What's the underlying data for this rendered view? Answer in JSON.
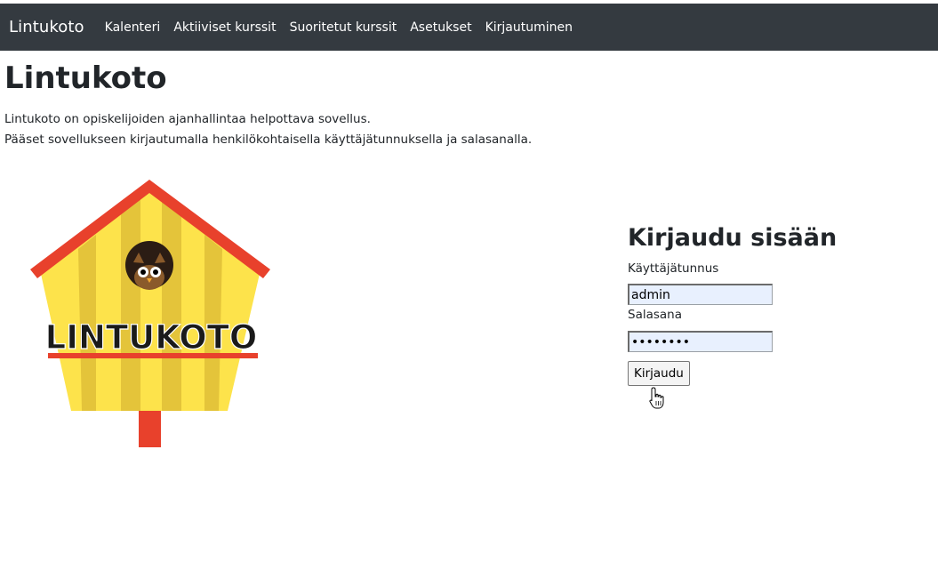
{
  "navbar": {
    "brand": "Lintukoto",
    "links": [
      "Kalenteri",
      "Aktiiviset kurssit",
      "Suoritetut kurssit",
      "Asetukset",
      "Kirjautuminen"
    ]
  },
  "page": {
    "title": "Lintukoto",
    "intro_lines": [
      "Lintukoto on opiskelijoiden ajanhallintaa helpottava sovellus.",
      "Pääset sovellukseen kirjautumalla henkilökohtaisella käyttäjätunnuksella ja salasanalla."
    ]
  },
  "logo": {
    "text": "LINTUKOTO",
    "icon": "birdhouse-owl-logo",
    "colors": {
      "roof": "#e8412c",
      "house": "#fde34b",
      "stripe": "#e4c43a",
      "post": "#e8412c",
      "text": "#1a1a1a"
    }
  },
  "login": {
    "heading": "Kirjaudu sisään",
    "username_label": "Käyttäjätunnus",
    "username_value": "admin",
    "password_label": "Salasana",
    "password_value": "••••••••",
    "submit_label": "Kirjaudu"
  },
  "colors": {
    "navbar_bg": "#343a40",
    "autofill_bg": "#e8f0fe"
  }
}
